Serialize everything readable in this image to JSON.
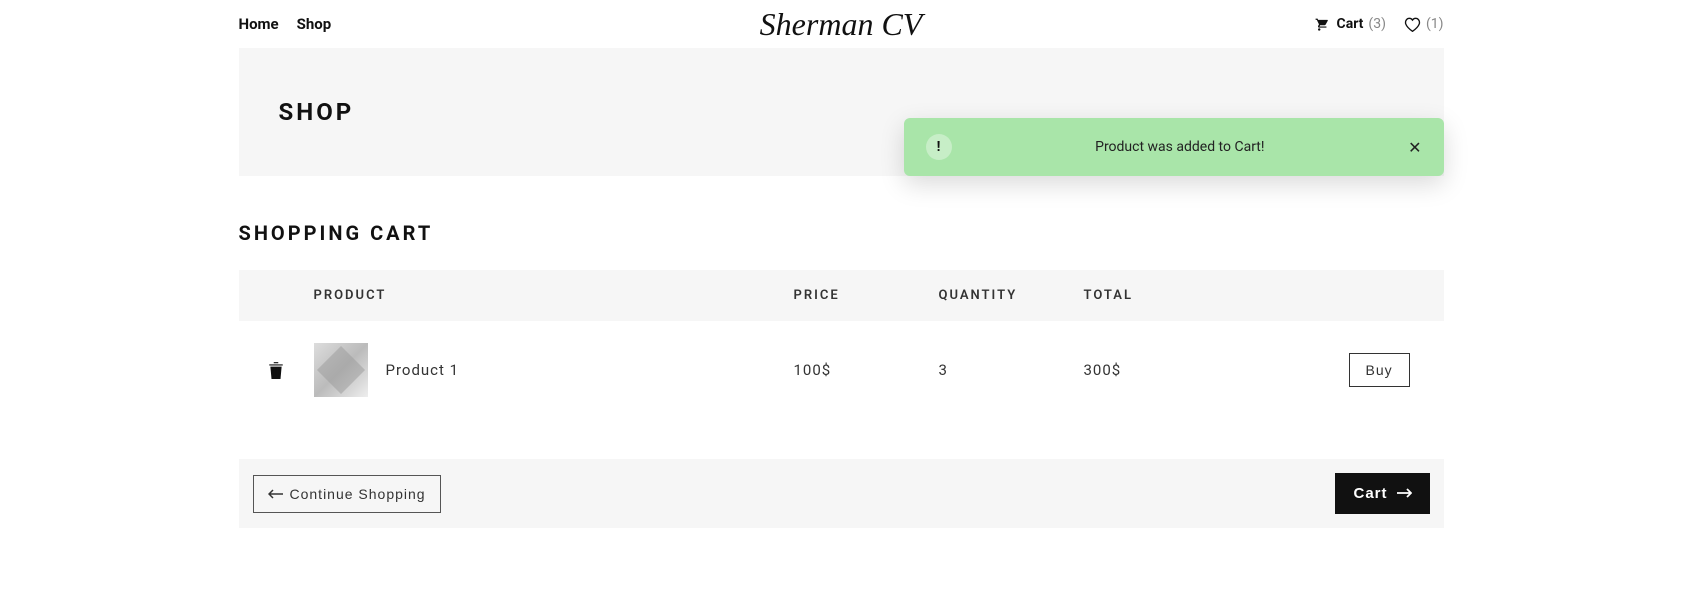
{
  "header": {
    "nav": {
      "home": "Home",
      "shop": "Shop"
    },
    "logo": "Sherman CV",
    "cart": {
      "label": "Cart",
      "count": "(3)"
    },
    "wishlist": {
      "count": "(1)"
    }
  },
  "banner": {
    "title": "SHOP"
  },
  "toast": {
    "icon": "!",
    "message": "Product was added to Cart!",
    "close": "✕"
  },
  "cart": {
    "title": "SHOPPING CART",
    "headers": {
      "product": "PRODUCT",
      "price": "PRICE",
      "quantity": "QUANTITY",
      "total": "TOTAL"
    },
    "items": [
      {
        "name": "Product 1",
        "price": "100$",
        "quantity": "3",
        "total": "300$",
        "action": "Buy"
      }
    ]
  },
  "footer": {
    "continue": "Continue Shopping",
    "cart": "Cart"
  }
}
